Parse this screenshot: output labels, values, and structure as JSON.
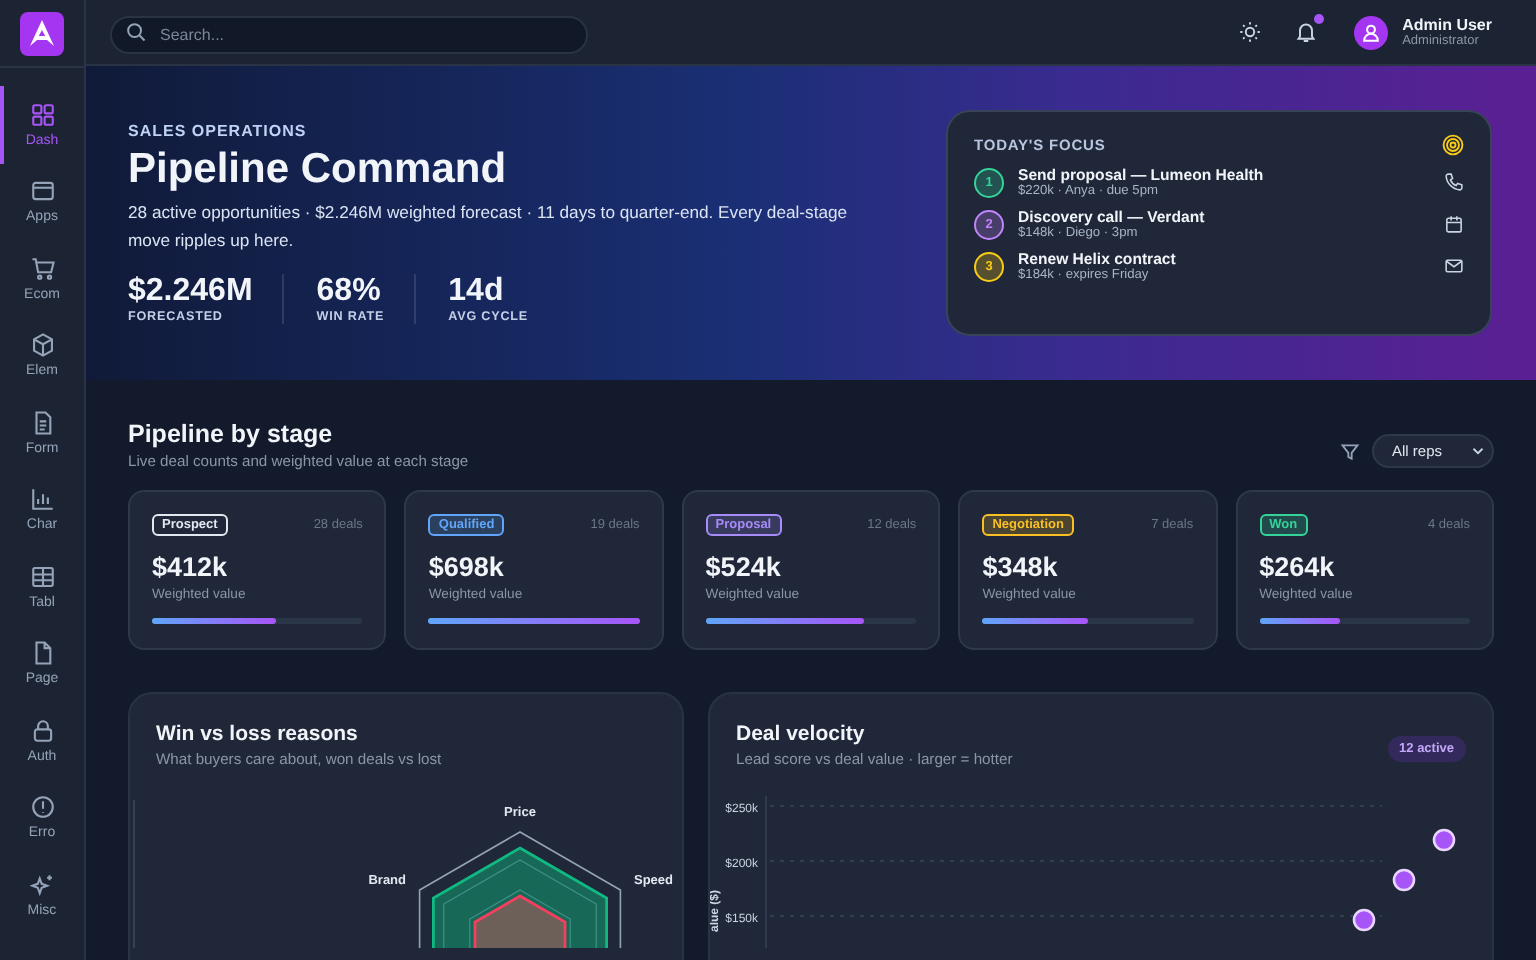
{
  "sidebar": {
    "items": [
      {
        "label": "Dash",
        "selected": true
      },
      {
        "label": "Apps",
        "selected": false
      },
      {
        "label": "Ecom",
        "selected": false
      },
      {
        "label": "Elem",
        "selected": false
      },
      {
        "label": "Form",
        "selected": false
      },
      {
        "label": "Char",
        "selected": false
      },
      {
        "label": "Tabl",
        "selected": false
      },
      {
        "label": "Page",
        "selected": false
      },
      {
        "label": "Auth",
        "selected": false
      },
      {
        "label": "Erro",
        "selected": false
      },
      {
        "label": "Misc",
        "selected": false
      }
    ]
  },
  "topbar": {
    "search": {
      "placeholder": "Search..."
    },
    "notifications_unread": true,
    "user": {
      "name": "Admin User",
      "role": "Administrator"
    }
  },
  "hero": {
    "eyebrow": "SALES OPERATIONS",
    "title": "Pipeline Command",
    "description": "28 active opportunities · $2.246M weighted forecast · 11 days to quarter-end. Every deal-stage move ripples up here.",
    "stats": [
      {
        "value": "$2.246M",
        "label": "FORECASTED"
      },
      {
        "value": "68%",
        "label": "WIN RATE"
      },
      {
        "value": "14d",
        "label": "AVG CYCLE"
      }
    ],
    "focus": {
      "title": "TODAY'S FOCUS",
      "items": [
        {
          "number": "1",
          "color": "#34d399",
          "title": "Send proposal — Lumeon Health",
          "meta": "$220k · Anya · due 5pm",
          "kind": "phone"
        },
        {
          "number": "2",
          "color": "#c084fc",
          "title": "Discovery call — Verdant",
          "meta": "$148k · Diego · 3pm",
          "kind": "calendar"
        },
        {
          "number": "3",
          "color": "#facc15",
          "title": "Renew Helix contract",
          "meta": "$184k · expires Friday",
          "kind": "mail"
        }
      ]
    }
  },
  "pipeline": {
    "title": "Pipeline by stage",
    "subtitle": "Live deal counts and weighted value at each stage",
    "filter": {
      "value": "All reps"
    },
    "stages": [
      {
        "name": "Prospect",
        "color": "#e2e8f0",
        "deals": "28 deals",
        "value": "$412k",
        "caption": "Weighted value",
        "level": 0.59
      },
      {
        "name": "Qualified",
        "color": "#60a5fa",
        "deals": "19 deals",
        "value": "$698k",
        "caption": "Weighted value",
        "level": 1.0
      },
      {
        "name": "Proposal",
        "color": "#a78bfa",
        "deals": "12 deals",
        "value": "$524k",
        "caption": "Weighted value",
        "level": 0.75
      },
      {
        "name": "Negotiation",
        "color": "#fbbf24",
        "deals": "7 deals",
        "value": "$348k",
        "caption": "Weighted value",
        "level": 0.5
      },
      {
        "name": "Won",
        "color": "#34d399",
        "deals": "4 deals",
        "value": "$264k",
        "caption": "Weighted value",
        "level": 0.38
      }
    ]
  },
  "win_loss": {
    "title": "Win vs loss reasons",
    "subtitle": "What buyers care about, won deals vs lost",
    "axes": [
      "Price",
      "Speed",
      "Brand"
    ]
  },
  "velocity": {
    "title": "Deal velocity",
    "subtitle": "Lead score vs deal value · larger = hotter",
    "badge": "12 active",
    "y_tick_labels": [
      "$250k",
      "$200k",
      "$150k"
    ],
    "ylabel": "alue ($)"
  }
}
